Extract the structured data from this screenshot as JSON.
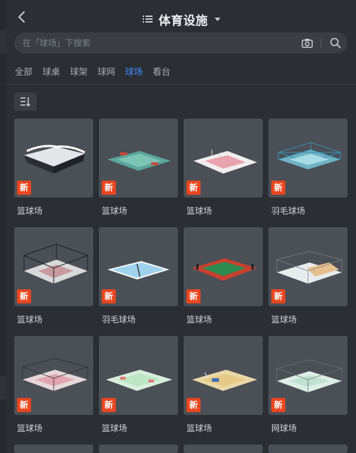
{
  "header": {
    "title": "体育设施"
  },
  "search": {
    "placeholder": "在「球场」下搜索"
  },
  "tabs": [
    {
      "label": "全部",
      "active": false
    },
    {
      "label": "球桌",
      "active": false
    },
    {
      "label": "球架",
      "active": false
    },
    {
      "label": "球网",
      "active": false
    },
    {
      "label": "球场",
      "active": true
    },
    {
      "label": "看台",
      "active": false
    }
  ],
  "items": [
    {
      "label": "篮球场",
      "badge": "新",
      "kind": "roof"
    },
    {
      "label": "篮球场",
      "badge": "新",
      "kind": "teal"
    },
    {
      "label": "篮球场",
      "badge": "新",
      "kind": "pink"
    },
    {
      "label": "羽毛球场",
      "badge": "新",
      "kind": "fenced-blue"
    },
    {
      "label": "篮球场",
      "badge": "新",
      "kind": "dark-fence"
    },
    {
      "label": "羽毛球场",
      "badge": "新",
      "kind": "light-blue"
    },
    {
      "label": "篮球场",
      "badge": "新",
      "kind": "red-green"
    },
    {
      "label": "篮球场",
      "badge": "新",
      "kind": "fenced-tan"
    },
    {
      "label": "篮球场",
      "badge": "新",
      "kind": "fenced-pink"
    },
    {
      "label": "篮球场",
      "badge": "新",
      "kind": "light-green"
    },
    {
      "label": "篮球场",
      "badge": "新",
      "kind": "tan"
    },
    {
      "label": "网球场",
      "badge": "新",
      "kind": "fenced-mint"
    }
  ],
  "colors": {
    "accent": "#3d8bff",
    "badge": "#e8461f"
  }
}
